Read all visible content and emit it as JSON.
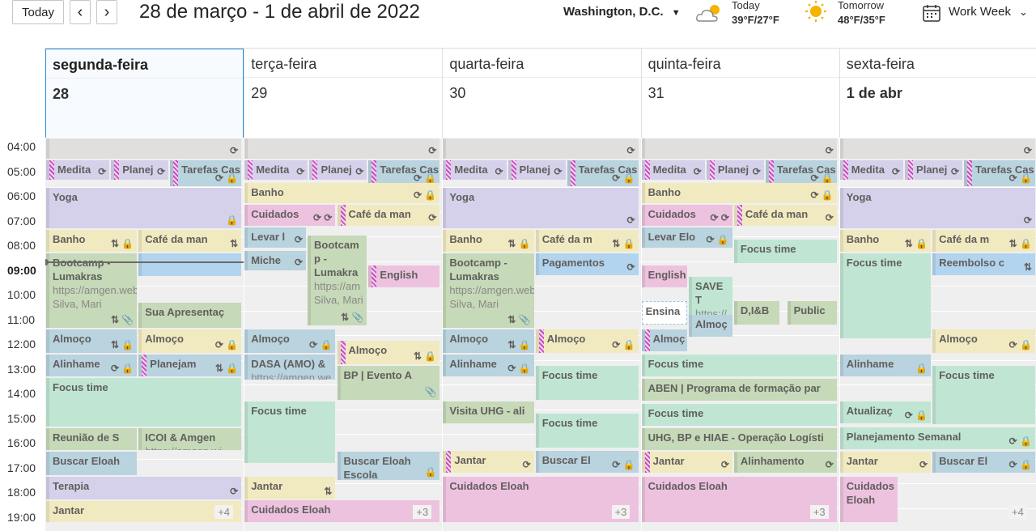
{
  "toolbar": {
    "today": "Today",
    "prev": "‹",
    "next": "›",
    "range": "28 de março - 1 de abril de 2022",
    "location": "Washington,  D.C.",
    "view": "Work Week"
  },
  "weather": [
    {
      "label": "Today",
      "temp": "39°F/27°F",
      "icon": "partly-cloudy-icon"
    },
    {
      "label": "Tomorrow",
      "temp": "48°F/35°F",
      "icon": "sunny-icon"
    }
  ],
  "days": [
    {
      "name": "segunda-feira",
      "date": "28"
    },
    {
      "name": "terça-feira",
      "date": "29"
    },
    {
      "name": "quarta-feira",
      "date": "30"
    },
    {
      "name": "quinta-feira",
      "date": "31"
    },
    {
      "name": "sexta-feira",
      "date": "1 de abr"
    }
  ],
  "times": [
    "04:00",
    "05:00",
    "06:00",
    "07:00",
    "08:00",
    "09:00",
    "10:00",
    "11:00",
    "12:00",
    "13:00",
    "14:00",
    "15:00",
    "16:00",
    "17:00",
    "18:00",
    "19:00"
  ],
  "colors": {
    "purple": "#d5d1ea",
    "teal": "#b9d3df",
    "yellow": "#f1eac1",
    "pink": "#edc2df",
    "green": "#c0e6d3",
    "blue": "#b3d4ee",
    "gray": "#e1dfdd",
    "sage": "#c6d9b8"
  },
  "events": [
    {
      "d": 0,
      "col": "gray",
      "title": "",
      "s": 4.0,
      "e": 4.9,
      "icons": "⟳"
    },
    {
      "d": 0,
      "col": "purple",
      "title": "Medita",
      "s": 4.9,
      "e": 5.75,
      "c": 0,
      "w": 0.33,
      "icons": "⟳",
      "chk": true
    },
    {
      "d": 0,
      "col": "purple",
      "title": "Planej",
      "s": 4.9,
      "e": 5.75,
      "c": 0.33,
      "w": 0.3,
      "icons": "⟳",
      "chk": true
    },
    {
      "d": 0,
      "col": "teal",
      "title": "Tarefas Cas",
      "s": 4.9,
      "e": 6.0,
      "c": 0.63,
      "w": 0.37,
      "icons": "⟳ 🔒",
      "chk": true
    },
    {
      "d": 0,
      "col": "purple",
      "title": "Yoga",
      "s": 6.0,
      "e": 7.7,
      "icons": "🔒"
    },
    {
      "d": 0,
      "col": "yellow",
      "title": "Banho",
      "s": 7.7,
      "e": 8.65,
      "c": 0,
      "w": 0.47,
      "icons": "⇅ 🔒"
    },
    {
      "d": 0,
      "col": "yellow",
      "title": "Café da man",
      "s": 7.7,
      "e": 8.65,
      "c": 0.47,
      "w": 0.53,
      "icons": "⇅"
    },
    {
      "d": 0,
      "col": "blue",
      "title": "",
      "s": 8.65,
      "e": 9.65,
      "c": 0.47,
      "w": 0.53,
      "icons": ""
    },
    {
      "d": 0,
      "col": "sage",
      "title": "Bootcamp - Lumakras",
      "sub": "https://amgen.webex.com/amgen Silva, Mari",
      "s": 8.65,
      "e": 11.75,
      "c": 0,
      "w": 0.47,
      "icons": "⇅ 📎"
    },
    {
      "d": 0,
      "col": "sage",
      "title": "Sua Apresentaç",
      "s": 10.65,
      "e": 11.75,
      "c": 0.47,
      "w": 0.53,
      "icons": ""
    },
    {
      "d": 0,
      "col": "teal",
      "title": "Almoço",
      "s": 11.75,
      "e": 12.75,
      "c": 0,
      "w": 0.47,
      "icons": "⇅ 🔒"
    },
    {
      "d": 0,
      "col": "yellow",
      "title": "Almoço",
      "s": 11.75,
      "e": 12.75,
      "c": 0.47,
      "w": 0.53,
      "icons": "⟳ 🔒"
    },
    {
      "d": 0,
      "col": "teal",
      "title": "Alinhame",
      "s": 12.75,
      "e": 13.7,
      "c": 0,
      "w": 0.47,
      "icons": "⟳ 🔒"
    },
    {
      "d": 0,
      "col": "teal",
      "title": "Planejam",
      "s": 12.75,
      "e": 13.7,
      "c": 0.47,
      "w": 0.53,
      "icons": "⇅ 🔒",
      "chk": true
    },
    {
      "d": 0,
      "col": "green",
      "title": "Focus time",
      "s": 13.7,
      "e": 15.75,
      "icons": ""
    },
    {
      "d": 0,
      "col": "sage",
      "title": "Reunião de S",
      "s": 15.75,
      "e": 16.7,
      "c": 0,
      "w": 0.47,
      "icons": ""
    },
    {
      "d": 0,
      "col": "sage",
      "title": "ICOI & Amgen",
      "sub": "https://amgen.wi",
      "s": 15.75,
      "e": 16.7,
      "c": 0.47,
      "w": 0.53,
      "icons": ""
    },
    {
      "d": 0,
      "col": "teal",
      "title": "Buscar Eloah",
      "s": 16.7,
      "e": 17.7,
      "c": 0,
      "w": 0.47,
      "icons": ""
    },
    {
      "d": 0,
      "col": "purple",
      "title": "Terapia",
      "s": 17.7,
      "e": 18.7,
      "icons": "⟳"
    },
    {
      "d": 0,
      "col": "yellow",
      "title": "Jantar",
      "s": 18.7,
      "e": 19.6,
      "more": "+4"
    },
    {
      "d": 1,
      "col": "gray",
      "title": "",
      "s": 4.0,
      "e": 4.9,
      "icons": "⟳"
    },
    {
      "d": 1,
      "col": "purple",
      "title": "Medita",
      "s": 4.9,
      "e": 5.75,
      "c": 0,
      "w": 0.33,
      "icons": "⟳",
      "chk": true
    },
    {
      "d": 1,
      "col": "purple",
      "title": "Planej",
      "s": 4.9,
      "e": 5.75,
      "c": 0.33,
      "w": 0.3,
      "icons": "⟳",
      "chk": true
    },
    {
      "d": 1,
      "col": "teal",
      "title": "Tarefas Cas",
      "s": 4.9,
      "e": 6.0,
      "c": 0.63,
      "w": 0.37,
      "icons": "⟳ 🔒",
      "chk": true
    },
    {
      "d": 1,
      "col": "yellow",
      "title": "Banho",
      "s": 5.8,
      "e": 6.7,
      "icons": "⟳ 🔒"
    },
    {
      "d": 1,
      "col": "pink",
      "title": "Cuidados",
      "s": 6.7,
      "e": 7.6,
      "c": 0,
      "w": 0.47,
      "icons": "⟳ ⟳"
    },
    {
      "d": 1,
      "col": "yellow",
      "title": "Café da man",
      "s": 6.7,
      "e": 7.6,
      "c": 0.47,
      "w": 0.53,
      "icons": "⟳",
      "chk": true
    },
    {
      "d": 1,
      "col": "teal",
      "title": "Levar l",
      "s": 7.6,
      "e": 8.5,
      "c": 0,
      "w": 0.32,
      "icons": "⟳"
    },
    {
      "d": 1,
      "col": "sage",
      "title": "Bootcam p - Lumakra",
      "sub": "https://am Silva, Mari",
      "s": 7.95,
      "e": 11.65,
      "c": 0.32,
      "w": 0.31,
      "icons": "⇅ 📎"
    },
    {
      "d": 1,
      "col": "teal",
      "title": "Miche",
      "s": 8.55,
      "e": 9.4,
      "c": 0,
      "w": 0.32,
      "icons": "⟳"
    },
    {
      "d": 1,
      "col": "pink",
      "title": "English",
      "s": 9.15,
      "e": 10.1,
      "c": 0.63,
      "w": 0.37,
      "icons": "",
      "chk": true
    },
    {
      "d": 1,
      "col": "teal",
      "title": "Almoço",
      "s": 11.75,
      "e": 12.75,
      "c": 0,
      "w": 0.47,
      "icons": "⟳ 🔒"
    },
    {
      "d": 1,
      "col": "yellow",
      "title": "Almoço",
      "s": 12.2,
      "e": 13.2,
      "c": 0.47,
      "w": 0.53,
      "icons": "⇅ 🔒",
      "chk": true
    },
    {
      "d": 1,
      "col": "teal",
      "title": "DASA (AMO) &",
      "sub": "https://amgen.we",
      "s": 12.75,
      "e": 13.85,
      "c": 0,
      "w": 0.47,
      "icons": ""
    },
    {
      "d": 1,
      "col": "sage",
      "title": "BP | Evento A",
      "s": 13.2,
      "e": 14.65,
      "c": 0.47,
      "w": 0.53,
      "icons": "📎"
    },
    {
      "d": 1,
      "col": "green",
      "title": "Focus time",
      "s": 14.65,
      "e": 17.2,
      "c": 0,
      "w": 0.47,
      "icons": ""
    },
    {
      "d": 1,
      "col": "teal",
      "title": "Buscar Eloah Escola",
      "s": 16.7,
      "e": 17.9,
      "c": 0.47,
      "w": 0.53,
      "icons": "🔒"
    },
    {
      "d": 1,
      "col": "yellow",
      "title": "Jantar",
      "s": 17.7,
      "e": 18.7,
      "c": 0,
      "w": 0.47,
      "icons": "⇅"
    },
    {
      "d": 1,
      "col": "pink",
      "title": "Cuidados Eloah",
      "s": 18.65,
      "e": 19.6,
      "more": "+3"
    },
    {
      "d": 2,
      "col": "gray",
      "title": "",
      "s": 4.0,
      "e": 4.9,
      "icons": "⟳"
    },
    {
      "d": 2,
      "col": "purple",
      "title": "Medita",
      "s": 4.9,
      "e": 5.75,
      "c": 0,
      "w": 0.33,
      "icons": "⟳",
      "chk": true
    },
    {
      "d": 2,
      "col": "purple",
      "title": "Planej",
      "s": 4.9,
      "e": 5.75,
      "c": 0.33,
      "w": 0.3,
      "icons": "⟳",
      "chk": true
    },
    {
      "d": 2,
      "col": "teal",
      "title": "Tarefas Cas",
      "s": 4.9,
      "e": 6.0,
      "c": 0.63,
      "w": 0.37,
      "icons": "⟳ 🔒",
      "chk": true
    },
    {
      "d": 2,
      "col": "purple",
      "title": "Yoga",
      "s": 6.0,
      "e": 7.7,
      "icons": "⟳"
    },
    {
      "d": 2,
      "col": "yellow",
      "title": "Banho",
      "s": 7.7,
      "e": 8.65,
      "c": 0,
      "w": 0.47,
      "icons": "⇅ 🔒"
    },
    {
      "d": 2,
      "col": "yellow",
      "title": "Café da m",
      "s": 7.7,
      "e": 8.65,
      "c": 0.47,
      "w": 0.53,
      "icons": "⇅ 🔒"
    },
    {
      "d": 2,
      "col": "sage",
      "title": "Bootcamp - Lumakras",
      "sub": "https://amgen.webex.com/amgen Silva, Mari",
      "s": 8.65,
      "e": 11.75,
      "c": 0,
      "w": 0.47,
      "icons": "⇅ 📎"
    },
    {
      "d": 2,
      "col": "blue",
      "title": "Pagamentos",
      "s": 8.65,
      "e": 9.6,
      "c": 0.47,
      "w": 0.53,
      "icons": "⟳"
    },
    {
      "d": 2,
      "col": "teal",
      "title": "Almoço",
      "s": 11.75,
      "e": 12.75,
      "c": 0,
      "w": 0.47,
      "icons": "⇅ 🔒"
    },
    {
      "d": 2,
      "col": "yellow",
      "title": "Almoço",
      "s": 11.75,
      "e": 12.75,
      "c": 0.47,
      "w": 0.53,
      "icons": "⟳ 🔒",
      "chk": true
    },
    {
      "d": 2,
      "col": "teal",
      "title": "Alinhame",
      "s": 12.75,
      "e": 13.7,
      "c": 0,
      "w": 0.47,
      "icons": "⟳ 🔒"
    },
    {
      "d": 2,
      "col": "green",
      "title": "Focus time",
      "s": 13.2,
      "e": 14.65,
      "c": 0.47,
      "w": 0.53,
      "icons": ""
    },
    {
      "d": 2,
      "col": "sage",
      "title": "Visita UHG - ali",
      "s": 14.65,
      "e": 15.6,
      "c": 0,
      "w": 0.47,
      "icons": ""
    },
    {
      "d": 2,
      "col": "green",
      "title": "Focus time",
      "s": 15.15,
      "e": 16.6,
      "c": 0.47,
      "w": 0.53,
      "icons": ""
    },
    {
      "d": 2,
      "col": "yellow",
      "title": "Jantar",
      "s": 16.65,
      "e": 17.6,
      "c": 0,
      "w": 0.47,
      "icons": "⟳",
      "chk": true
    },
    {
      "d": 2,
      "col": "teal",
      "title": "Buscar El",
      "s": 16.65,
      "e": 17.6,
      "c": 0.47,
      "w": 0.53,
      "icons": "⟳ 🔒"
    },
    {
      "d": 2,
      "col": "pink",
      "title": "Cuidados Eloah",
      "s": 17.7,
      "e": 19.6,
      "more": "+3"
    },
    {
      "d": 3,
      "col": "gray",
      "title": "",
      "s": 4.0,
      "e": 4.9,
      "icons": "⟳"
    },
    {
      "d": 3,
      "col": "purple",
      "title": "Medita",
      "s": 4.9,
      "e": 5.75,
      "c": 0,
      "w": 0.33,
      "icons": "⟳",
      "chk": true
    },
    {
      "d": 3,
      "col": "purple",
      "title": "Planej",
      "s": 4.9,
      "e": 5.75,
      "c": 0.33,
      "w": 0.3,
      "icons": "⟳",
      "chk": true
    },
    {
      "d": 3,
      "col": "teal",
      "title": "Tarefas Cas",
      "s": 4.9,
      "e": 6.0,
      "c": 0.63,
      "w": 0.37,
      "icons": "⟳ 🔒",
      "chk": true
    },
    {
      "d": 3,
      "col": "yellow",
      "title": "Banho",
      "s": 5.8,
      "e": 6.7,
      "icons": "⟳ 🔒"
    },
    {
      "d": 3,
      "col": "pink",
      "title": "Cuidados",
      "s": 6.7,
      "e": 7.6,
      "c": 0,
      "w": 0.47,
      "icons": "⟳ ⟳"
    },
    {
      "d": 3,
      "col": "yellow",
      "title": "Café da man",
      "s": 6.7,
      "e": 7.6,
      "c": 0.47,
      "w": 0.53,
      "icons": "⟳",
      "chk": true
    },
    {
      "d": 3,
      "col": "teal",
      "title": "Levar Elo",
      "s": 7.6,
      "e": 8.5,
      "c": 0,
      "w": 0.47,
      "icons": "⟳ 🔒"
    },
    {
      "d": 3,
      "col": "green",
      "title": "Focus time",
      "s": 8.1,
      "e": 9.1,
      "c": 0.47,
      "w": 0.53,
      "icons": ""
    },
    {
      "d": 3,
      "col": "pink",
      "title": "English",
      "s": 9.15,
      "e": 10.1,
      "c": 0,
      "w": 0.24,
      "icons": ""
    },
    {
      "d": 3,
      "col": "green",
      "title": "SAVE T",
      "sub": "https://",
      "s": 9.6,
      "e": 11.6,
      "c": 0.24,
      "w": 0.23,
      "icons": ""
    },
    {
      "d": 3,
      "col": "dashed",
      "title": "Ensina",
      "s": 10.6,
      "e": 11.6,
      "c": 0,
      "w": 0.24,
      "icons": ""
    },
    {
      "d": 3,
      "col": "teal",
      "title": "Almoç",
      "s": 11.15,
      "e": 12.1,
      "c": 0.24,
      "w": 0.23,
      "icons": ""
    },
    {
      "d": 3,
      "col": "sage",
      "title": "D,I&B",
      "s": 10.6,
      "e": 11.6,
      "c": 0.47,
      "w": 0.24,
      "icons": ""
    },
    {
      "d": 3,
      "col": "sage",
      "title": "Public",
      "s": 10.6,
      "e": 11.6,
      "c": 0.74,
      "w": 0.26,
      "icons": ""
    },
    {
      "d": 3,
      "col": "teal",
      "title": "Almoç",
      "s": 11.75,
      "e": 12.7,
      "c": 0,
      "w": 0.24,
      "icons": "",
      "chk": true
    },
    {
      "d": 3,
      "col": "green",
      "title": "Focus time",
      "s": 12.75,
      "e": 13.7,
      "icons": ""
    },
    {
      "d": 3,
      "col": "sage",
      "title": "ABEN | Programa de formação par",
      "s": 13.75,
      "e": 14.7,
      "icons": ""
    },
    {
      "d": 3,
      "col": "green",
      "title": "Focus time",
      "s": 14.75,
      "e": 15.7,
      "icons": ""
    },
    {
      "d": 3,
      "col": "sage",
      "title": "UHG, BP e HIAE - Operação Logísti",
      "s": 15.75,
      "e": 16.7,
      "icons": ""
    },
    {
      "d": 3,
      "col": "yellow",
      "title": "Jantar",
      "s": 16.7,
      "e": 17.6,
      "c": 0,
      "w": 0.47,
      "icons": "⟳",
      "chk": true
    },
    {
      "d": 3,
      "col": "sage",
      "title": "Alinhamento",
      "s": 16.7,
      "e": 17.6,
      "c": 0.47,
      "w": 0.53,
      "icons": "⟳"
    },
    {
      "d": 3,
      "col": "pink",
      "title": "Cuidados Eloah",
      "s": 17.7,
      "e": 19.6,
      "more": "+3"
    },
    {
      "d": 4,
      "col": "gray",
      "title": "",
      "s": 4.0,
      "e": 4.9,
      "icons": "⟳"
    },
    {
      "d": 4,
      "col": "purple",
      "title": "Medita",
      "s": 4.9,
      "e": 5.75,
      "c": 0,
      "w": 0.33,
      "icons": "⟳",
      "chk": true
    },
    {
      "d": 4,
      "col": "purple",
      "title": "Planej",
      "s": 4.9,
      "e": 5.75,
      "c": 0.33,
      "w": 0.3,
      "icons": "⟳",
      "chk": true
    },
    {
      "d": 4,
      "col": "teal",
      "title": "Tarefas Cas",
      "s": 4.9,
      "e": 6.0,
      "c": 0.63,
      "w": 0.37,
      "icons": "⟳ 🔒",
      "chk": true
    },
    {
      "d": 4,
      "col": "purple",
      "title": "Yoga",
      "s": 6.0,
      "e": 7.7,
      "icons": "⟳"
    },
    {
      "d": 4,
      "col": "yellow",
      "title": "Banho",
      "s": 7.7,
      "e": 8.65,
      "c": 0,
      "w": 0.47,
      "icons": "⇅ 🔒"
    },
    {
      "d": 4,
      "col": "yellow",
      "title": "Café da m",
      "s": 7.7,
      "e": 8.65,
      "c": 0.47,
      "w": 0.53,
      "icons": "⇅ 🔒"
    },
    {
      "d": 4,
      "col": "green",
      "title": "Focus time",
      "s": 8.65,
      "e": 12.15,
      "c": 0,
      "w": 0.47,
      "icons": ""
    },
    {
      "d": 4,
      "col": "blue",
      "title": "Reembolso c",
      "s": 8.65,
      "e": 9.6,
      "c": 0.47,
      "w": 0.53,
      "icons": "⇅"
    },
    {
      "d": 4,
      "col": "yellow",
      "title": "Almoço",
      "s": 11.75,
      "e": 12.75,
      "c": 0.47,
      "w": 0.53,
      "icons": "⟳ 🔒"
    },
    {
      "d": 4,
      "col": "teal",
      "title": "Alinhame",
      "s": 12.75,
      "e": 13.7,
      "c": 0,
      "w": 0.47,
      "icons": "🔒"
    },
    {
      "d": 4,
      "col": "green",
      "title": "Focus time",
      "s": 13.2,
      "e": 15.65,
      "c": 0.47,
      "w": 0.53,
      "icons": ""
    },
    {
      "d": 4,
      "col": "green",
      "title": "Atualizaç",
      "s": 14.65,
      "e": 15.6,
      "c": 0,
      "w": 0.47,
      "icons": "⟳ 🔒"
    },
    {
      "d": 4,
      "col": "green",
      "title": "Planejamento Semanal",
      "s": 15.7,
      "e": 16.65,
      "icons": "⟳ 🔒"
    },
    {
      "d": 4,
      "col": "yellow",
      "title": "Jantar",
      "s": 16.7,
      "e": 17.6,
      "c": 0,
      "w": 0.47,
      "icons": "⟳"
    },
    {
      "d": 4,
      "col": "teal",
      "title": "Buscar El",
      "s": 16.7,
      "e": 17.6,
      "c": 0.47,
      "w": 0.53,
      "icons": "⟳ 🔒"
    },
    {
      "d": 4,
      "col": "pink",
      "title": "Cuidados Eloah",
      "s": 17.7,
      "e": 19.6,
      "c": 0,
      "w": 0.3,
      "more": "+4"
    }
  ]
}
